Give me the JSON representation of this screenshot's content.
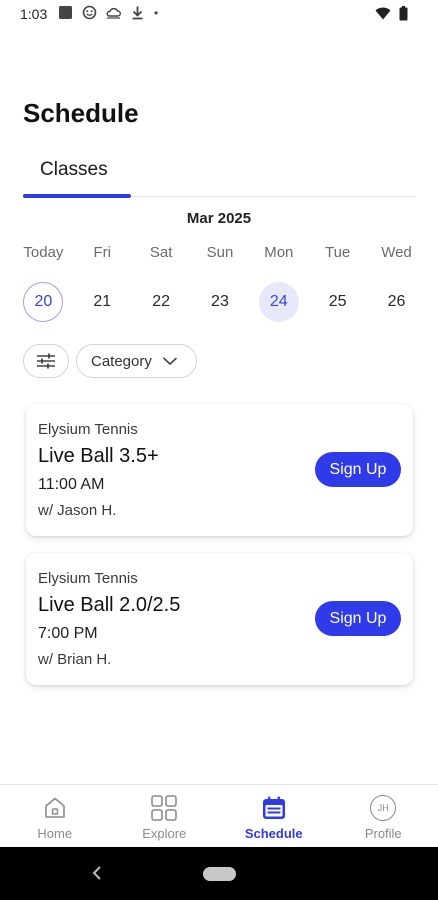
{
  "status_bar": {
    "time": "1:03",
    "icons": [
      "square-notification-icon",
      "heart-face-icon",
      "cloud-icon",
      "download-icon",
      "dot-icon",
      "wifi-icon",
      "battery-icon"
    ],
    "dot": "•"
  },
  "page": {
    "title": "Schedule"
  },
  "tabs": [
    {
      "label": "Classes",
      "active": true
    }
  ],
  "calendar": {
    "month": "Mar 2025",
    "days": [
      {
        "name": "Today",
        "number": "20",
        "state": "today"
      },
      {
        "name": "Fri",
        "number": "21",
        "state": ""
      },
      {
        "name": "Sat",
        "number": "22",
        "state": ""
      },
      {
        "name": "Sun",
        "number": "23",
        "state": ""
      },
      {
        "name": "Mon",
        "number": "24",
        "state": "selected"
      },
      {
        "name": "Tue",
        "number": "25",
        "state": ""
      },
      {
        "name": "Wed",
        "number": "26",
        "state": ""
      }
    ]
  },
  "filters": {
    "category_label": "Category"
  },
  "classes": [
    {
      "venue": "Elysium Tennis",
      "name": "Live Ball 3.5+",
      "time": "11:00 AM",
      "instructor": "w/ Jason H.",
      "button": "Sign Up"
    },
    {
      "venue": "Elysium Tennis",
      "name": "Live Ball 2.0/2.5",
      "time": "7:00 PM",
      "instructor": "w/ Brian H.",
      "button": "Sign Up"
    }
  ],
  "bottom_nav": {
    "items": [
      {
        "label": "Home",
        "icon": "home-icon",
        "active": false
      },
      {
        "label": "Explore",
        "icon": "grid-icon",
        "active": false
      },
      {
        "label": "Schedule",
        "icon": "calendar-icon",
        "active": true
      },
      {
        "label": "Profile",
        "icon": "avatar",
        "active": false
      }
    ],
    "avatar_initials": "JH"
  },
  "colors": {
    "accent": "#2f3be8",
    "selected_bg": "#e7e9fb",
    "muted": "#8a8a8f"
  }
}
